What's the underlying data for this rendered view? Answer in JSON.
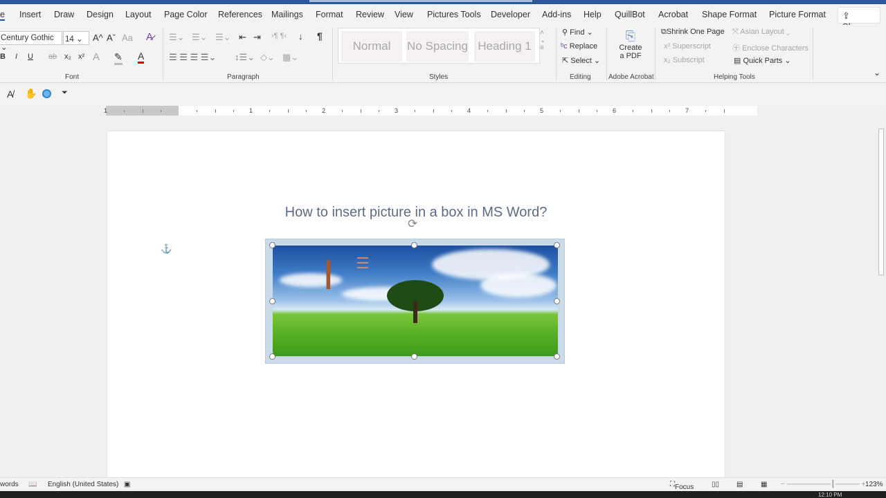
{
  "tabs": [
    "e",
    "Insert",
    "Draw",
    "Design",
    "Layout",
    "Page Color",
    "References",
    "Mailings",
    "Format",
    "Review",
    "View",
    "Pictures Tools",
    "Developer",
    "Add-ins",
    "Help",
    "QuillBot",
    "Acrobat",
    "Shape Format",
    "Picture Format"
  ],
  "share": "Share",
  "font": {
    "name": "Century Gothic",
    "size": "14",
    "label": "Font",
    "bold": "B",
    "italic": "I",
    "underline": "U",
    "strike": "ab",
    "sub": "x₂",
    "sup": "x²",
    "grow": "A^",
    "shrink": "Aˇ",
    "case": "Aa",
    "color": "A"
  },
  "paragraph": {
    "label": "Paragraph",
    "pilcrow": "¶"
  },
  "styles": {
    "label": "Styles",
    "items": [
      "Normal",
      "No Spacing",
      "Heading 1"
    ]
  },
  "editing": {
    "label": "Editing",
    "find": "Find",
    "replace": "Replace",
    "select": "Select"
  },
  "acrobat": {
    "label": "Adobe Acrobat",
    "create": "Create",
    "pdf": "a PDF"
  },
  "helping": {
    "label": "Helping Tools",
    "shrink": "Shrink One Page",
    "asian": "Asian Layout",
    "superscript": "Superscript",
    "enclose": "Enclose Characters",
    "subscript": "Subscript",
    "quickparts": "Quick Parts"
  },
  "ruler": [
    "1",
    "1",
    "2",
    "3",
    "4",
    "5",
    "6",
    "7"
  ],
  "document": {
    "heading": "How to insert picture in a box in MS Word?"
  },
  "status": {
    "words": "words",
    "language": "English (United States)",
    "focus": "Focus",
    "zoom": "123%"
  },
  "taskbar": {
    "time": "12:10 PM"
  }
}
